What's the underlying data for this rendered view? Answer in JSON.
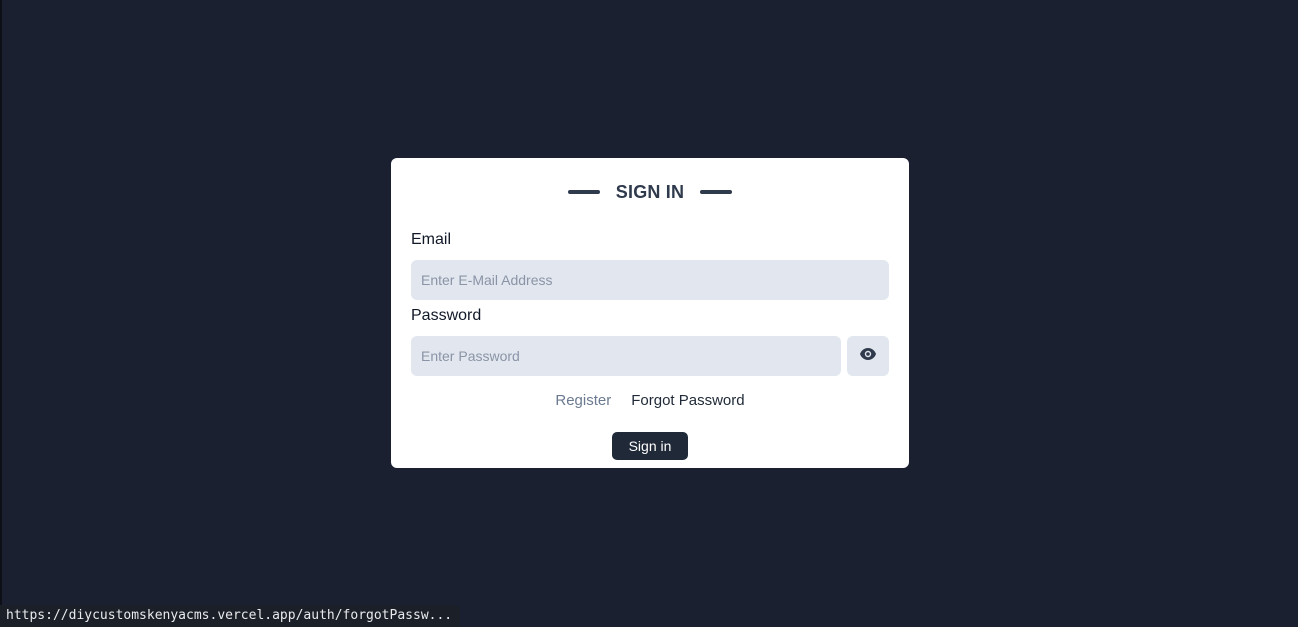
{
  "signin_card": {
    "title": "SIGN IN",
    "email_label": "Email",
    "email_value": "",
    "email_placeholder": "Enter E-Mail Address",
    "password_label": "Password",
    "password_value": "",
    "password_placeholder": "Enter Password",
    "toggle_visibility_icon": "eye-icon",
    "register_label": "Register",
    "forgot_password_label": "Forgot Password",
    "signin_button_label": "Sign in"
  },
  "status_bar": {
    "url": "https://diycustomskenyacms.vercel.app/auth/forgotPassw..."
  },
  "colors": {
    "background": "#1a2030",
    "card": "#ffffff",
    "input_bg": "#e2e7ef",
    "primary_button": "#1f2937",
    "link_muted": "#6b7a90"
  }
}
